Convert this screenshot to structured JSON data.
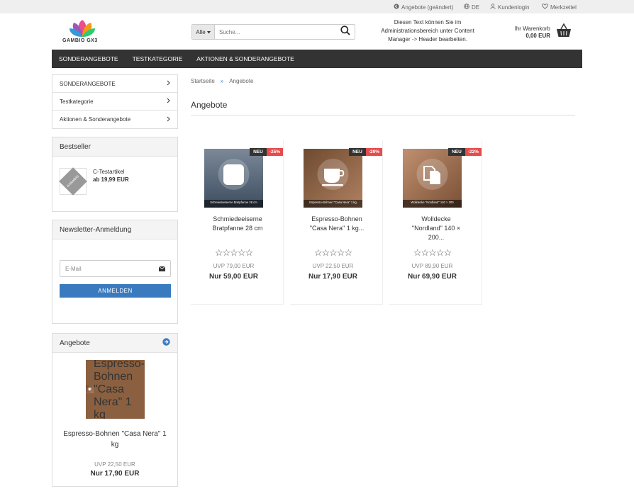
{
  "topbar": {
    "offers_link": "Angebote (geändert)",
    "language": "DE",
    "login": "Kundenlogin",
    "wishlist": "Merkzettel"
  },
  "header": {
    "logo_text": "GAMBIO GX3",
    "search_select": "Alle",
    "search_placeholder": "Suche...",
    "info_text_1": "Diesen Text können Sie im",
    "info_text_2": "Administrationsbereich unter Content",
    "info_text_3": "Manager -> Header bearbeiten.",
    "cart_label": "Ihr Warenkorb",
    "cart_total": "0,00 EUR"
  },
  "nav": [
    "SONDERANGEBOTE",
    "TESTKATEGORIE",
    "AKTIONEN & SONDERANGEBOTE"
  ],
  "sidebar": {
    "categories": [
      "SONDERANGEBOTE",
      "Testkategorie",
      "Aktionen & Sonderangebote"
    ],
    "bestseller": {
      "title": "Bestseller",
      "product": "C-Testartikel",
      "price": "ab 19,99 EUR",
      "placeholder": "Artikelbild"
    },
    "newsletter": {
      "title": "Newsletter-Anmeldung",
      "placeholder": "E-Mail",
      "button": "ANMELDEN"
    },
    "offers": {
      "title": "Angebote",
      "name_1": "Espresso-Bohnen \"Casa Nera\" 1",
      "name_2": "kg",
      "image_caption": "Espresso-Bohnen \"Casa Nera\" 1 kg",
      "uvp": "UVP 22,50 EUR",
      "price": "Nur 17,90 EUR"
    }
  },
  "main": {
    "breadcrumb_home": "Startseite",
    "breadcrumb_sep": "»",
    "breadcrumb_current": "Angebote",
    "title": "Angebote",
    "products": [
      {
        "name_1": "Schmiedeeiserne",
        "name_2": "Bratpfanne 28 cm",
        "name_3": "",
        "caption": "Schmiedeeiserne Bratpfanne 28 cm",
        "new": "NEU",
        "discount": "-25%",
        "uvp": "UVP 79,00 EUR",
        "price": "Nur 59,00 EUR",
        "bg": "#5a6b7e"
      },
      {
        "name_1": "Espresso-Bohnen",
        "name_2": "\"Casa Nera\" 1 kg...",
        "name_3": "",
        "caption": "Espresso-Bohnen \"Casa Nera\" 1 kg",
        "new": "NEU",
        "discount": "-20%",
        "uvp": "UVP 22,50 EUR",
        "price": "Nur 17,90 EUR",
        "bg": "#8a6040"
      },
      {
        "name_1": "Wolldecke",
        "name_2": "\"Nordland\" 140 ×",
        "name_3": "200...",
        "caption": "Wolldecke \"Nordland\" 140 × 200",
        "new": "NEU",
        "discount": "-22%",
        "uvp": "UVP 89,90 EUR",
        "price": "Nur 69,90 EUR",
        "bg": "#9a7050"
      }
    ],
    "stars": "☆☆☆☆☆"
  },
  "colors": {
    "nav_bg": "#333333",
    "accent_blue": "#3a7bc0",
    "badge_red": "#e54c4c"
  }
}
